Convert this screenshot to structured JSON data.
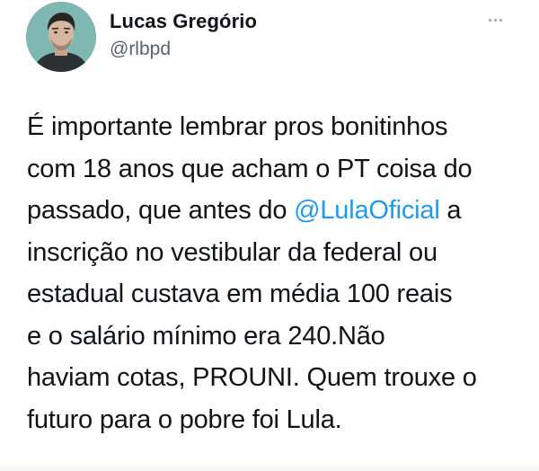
{
  "author": {
    "display_name": "Lucas Gregório",
    "handle": "@rlbpd",
    "avatar_icon": "profile-photo"
  },
  "more_icon": "more-horizontal-icon",
  "tweet": {
    "line1": "É importante lembrar pros bonitinhos",
    "line2": "com 18 anos que acham o PT coisa do",
    "line3_before": "passado, que antes do ",
    "line3_mention": "@LulaOficial",
    "line3_after": " a",
    "line4": "inscrição no vestibular da federal ou",
    "line5": "estadual custava em média 100 reais",
    "line6": "e o salário mínimo era 240.Não",
    "line7": "haviam cotas, PROUNI. Quem trouxe o",
    "line8": "futuro para o pobre foi Lula."
  },
  "colors": {
    "text": "#0f1419",
    "secondary": "#536471",
    "link": "#1d9bf0",
    "avatar_bg": "#7fb7b2"
  }
}
